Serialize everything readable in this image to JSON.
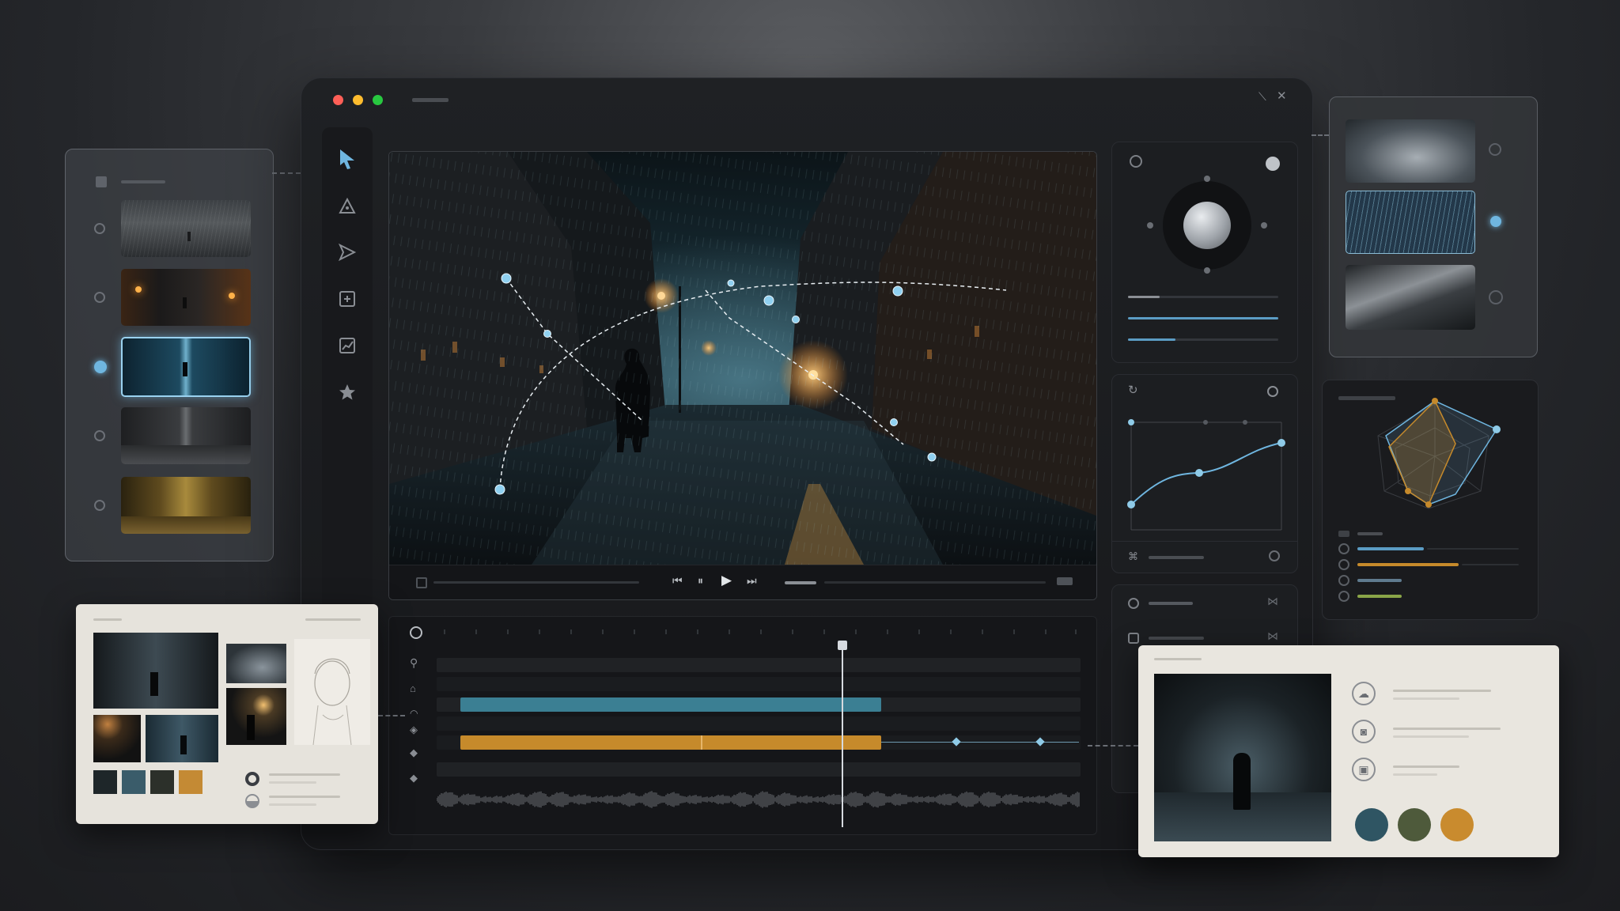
{
  "window": {
    "title": "",
    "traffic_lights": [
      "#ff5f57",
      "#febc2e",
      "#28c840"
    ]
  },
  "tools": [
    "select-arrow-icon",
    "pen-icon",
    "direction-icon",
    "add-frame-icon",
    "chart-icon",
    "star-icon"
  ],
  "left_panel": {
    "thumbnails": [
      {
        "name": "rain-street-mist",
        "selected": false
      },
      {
        "name": "warm-street-night",
        "selected": false
      },
      {
        "name": "blue-alley-figure",
        "selected": true
      },
      {
        "name": "grey-alley",
        "selected": false
      },
      {
        "name": "golden-alley",
        "selected": false
      }
    ]
  },
  "right_thumbs": [
    {
      "name": "storm-clouds",
      "selected": false
    },
    {
      "name": "rain-texture",
      "selected": true
    },
    {
      "name": "wet-pavement",
      "selected": false
    }
  ],
  "colors": {
    "accent_blue": "#6fb6e0",
    "track_teal": "#3b7f93",
    "track_amber": "#c68a2b",
    "swatches": [
      "#1e2629",
      "#3a5c6a",
      "#2c302a",
      "#c48a34"
    ],
    "ref_swatches": [
      "#2f5563",
      "#4e5a3b",
      "#c98b2e"
    ]
  },
  "ref_card_icons": [
    "cloud-rain-icon",
    "camera-icon",
    "photo-icon"
  ]
}
